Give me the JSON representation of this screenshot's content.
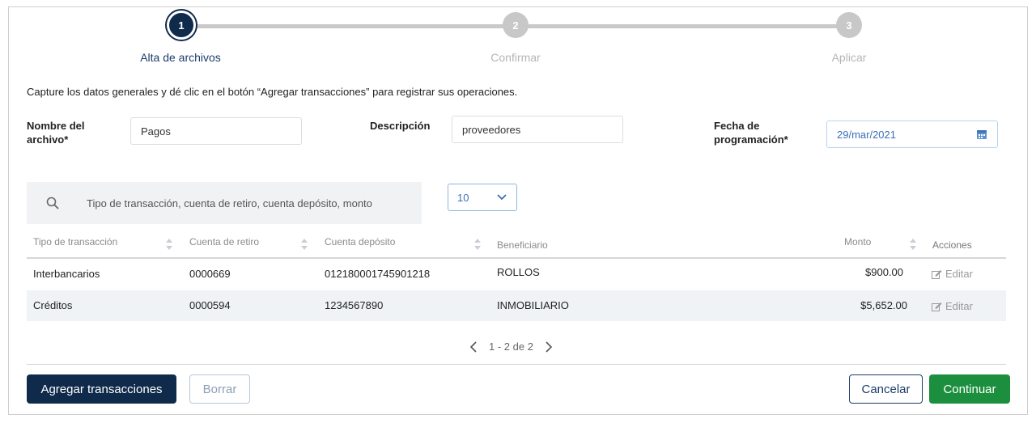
{
  "stepper": {
    "steps": [
      {
        "number": "1",
        "label": "Alta de archivos",
        "state": "active"
      },
      {
        "number": "2",
        "label": "Confirmar",
        "state": "inactive"
      },
      {
        "number": "3",
        "label": "Aplicar",
        "state": "inactive"
      }
    ]
  },
  "intro_text": "Capture los datos generales y dé clic en el botón “Agregar transacciones” para registrar sus operaciones.",
  "form": {
    "file_name_label_line1": "Nombre del",
    "file_name_label_line2": "archivo*",
    "file_name_value": "Pagos",
    "description_label": "Descripción",
    "description_value": "proveedores",
    "schedule_label_line1": "Fecha de",
    "schedule_label_line2": "programación*",
    "schedule_value": "29/mar/2021"
  },
  "search": {
    "placeholder": "Tipo de transacción, cuenta de retiro, cuenta depósito, monto"
  },
  "page_size": {
    "selected": "10"
  },
  "table": {
    "headers": {
      "type": "Tipo de transacción",
      "withdraw": "Cuenta de retiro",
      "deposit": "Cuenta depósito",
      "beneficiary": "Beneficiario",
      "amount": "Monto",
      "actions": "Acciones"
    },
    "rows": [
      {
        "type": "Interbancarios",
        "withdraw": "0000669",
        "deposit": "012180001745901218",
        "beneficiary": "ROLLOS",
        "amount": "$900.00",
        "action": "Editar"
      },
      {
        "type": "Créditos",
        "withdraw": "0000594",
        "deposit": "1234567890",
        "beneficiary": "INMOBILIARIO",
        "amount": "$5,652.00",
        "action": "Editar"
      }
    ]
  },
  "pagination": {
    "text": "1 - 2 de 2"
  },
  "buttons": {
    "add": "Agregar transacciones",
    "clear": "Borrar",
    "cancel": "Cancelar",
    "continue": "Continuar"
  },
  "colors": {
    "primary": "#0f2a4a",
    "success": "#1c8f3e",
    "accent_blue": "#3b6fb6"
  }
}
